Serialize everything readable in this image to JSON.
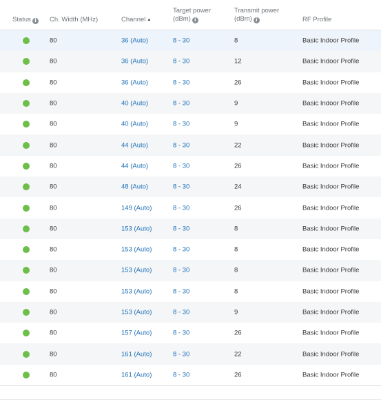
{
  "headers": {
    "status": "Status",
    "ch_width": "Ch. Width (MHz)",
    "channel": "Channel",
    "target_power_line1": "Target power",
    "target_power_line2": "(dBm)",
    "transmit_power_line1": "Transmit power",
    "transmit_power_line2": "(dBm)",
    "rf_profile": "RF Profile",
    "info_glyph": "i",
    "sort_glyph": "▲"
  },
  "colors": {
    "status_ok": "#6ebe4a",
    "link": "#1f6fb5",
    "header_text": "#6e7378"
  },
  "rows": [
    {
      "status": "online",
      "width": "80",
      "channel": "36 (Auto)",
      "target": "8 - 30",
      "transmit": "8",
      "rf": "Basic Indoor Profile"
    },
    {
      "status": "online",
      "width": "80",
      "channel": "36 (Auto)",
      "target": "8 - 30",
      "transmit": "12",
      "rf": "Basic Indoor Profile"
    },
    {
      "status": "online",
      "width": "80",
      "channel": "36 (Auto)",
      "target": "8 - 30",
      "transmit": "26",
      "rf": "Basic Indoor Profile"
    },
    {
      "status": "online",
      "width": "80",
      "channel": "40 (Auto)",
      "target": "8 - 30",
      "transmit": "9",
      "rf": "Basic Indoor Profile"
    },
    {
      "status": "online",
      "width": "80",
      "channel": "40 (Auto)",
      "target": "8 - 30",
      "transmit": "9",
      "rf": "Basic Indoor Profile"
    },
    {
      "status": "online",
      "width": "80",
      "channel": "44 (Auto)",
      "target": "8 - 30",
      "transmit": "22",
      "rf": "Basic Indoor Profile"
    },
    {
      "status": "online",
      "width": "80",
      "channel": "44 (Auto)",
      "target": "8 - 30",
      "transmit": "26",
      "rf": "Basic Indoor Profile"
    },
    {
      "status": "online",
      "width": "80",
      "channel": "48 (Auto)",
      "target": "8 - 30",
      "transmit": "24",
      "rf": "Basic Indoor Profile"
    },
    {
      "status": "online",
      "width": "80",
      "channel": "149 (Auto)",
      "target": "8 - 30",
      "transmit": "26",
      "rf": "Basic Indoor Profile"
    },
    {
      "status": "online",
      "width": "80",
      "channel": "153 (Auto)",
      "target": "8 - 30",
      "transmit": "8",
      "rf": "Basic Indoor Profile"
    },
    {
      "status": "online",
      "width": "80",
      "channel": "153 (Auto)",
      "target": "8 - 30",
      "transmit": "8",
      "rf": "Basic Indoor Profile"
    },
    {
      "status": "online",
      "width": "80",
      "channel": "153 (Auto)",
      "target": "8 - 30",
      "transmit": "8",
      "rf": "Basic Indoor Profile"
    },
    {
      "status": "online",
      "width": "80",
      "channel": "153 (Auto)",
      "target": "8 - 30",
      "transmit": "8",
      "rf": "Basic Indoor Profile"
    },
    {
      "status": "online",
      "width": "80",
      "channel": "153 (Auto)",
      "target": "8 - 30",
      "transmit": "9",
      "rf": "Basic Indoor Profile"
    },
    {
      "status": "online",
      "width": "80",
      "channel": "157 (Auto)",
      "target": "8 - 30",
      "transmit": "26",
      "rf": "Basic Indoor Profile"
    },
    {
      "status": "online",
      "width": "80",
      "channel": "161 (Auto)",
      "target": "8 - 30",
      "transmit": "22",
      "rf": "Basic Indoor Profile"
    },
    {
      "status": "online",
      "width": "80",
      "channel": "161 (Auto)",
      "target": "8 - 30",
      "transmit": "26",
      "rf": "Basic Indoor Profile"
    }
  ]
}
